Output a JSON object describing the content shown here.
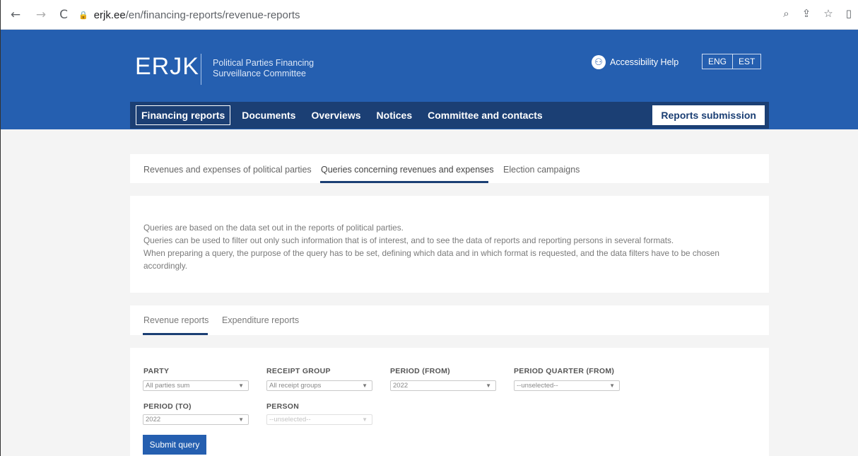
{
  "browser": {
    "back": "←",
    "forward": "→",
    "reload": "C",
    "lock": "🔒",
    "url_host": "erjk.ee",
    "url_path": "/en/financing-reports/revenue-reports",
    "icons": [
      "zoom-icon",
      "share-icon",
      "star-icon",
      "sidebar-icon"
    ]
  },
  "header": {
    "logo": "ERJK",
    "subtitle_line1": "Political Parties Financing",
    "subtitle_line2": "Surveillance Committee",
    "accessibility": "Accessibility Help",
    "lang_eng": "ENG",
    "lang_est": "EST"
  },
  "nav": {
    "items": [
      "Financing reports",
      "Documents",
      "Overviews",
      "Notices",
      "Committee and contacts"
    ],
    "reports_submission": "Reports submission"
  },
  "tabs": {
    "items": [
      "Revenues and expenses of political parties",
      "Queries concerning revenues and expenses",
      "Election campaigns"
    ],
    "active": "Queries concerning revenues and expenses"
  },
  "info": {
    "line1": "Queries are based on the data set out in the reports of political parties.",
    "line2": "Queries can be used to filter out only such information that is of interest, and to see the data of reports and reporting persons in several formats.",
    "line3": "When preparing a query, the purpose of the query has to be set, defining which data and in which format is requested, and the data filters have to be chosen accordingly."
  },
  "reports_tabs": {
    "revenue": "Revenue reports",
    "expenditure": "Expenditure reports"
  },
  "form": {
    "party_label": "PARTY",
    "party_value": "All parties sum",
    "receipt_label": "RECEIPT GROUP",
    "receipt_value": "All receipt groups",
    "period_from_label": "PERIOD (FROM)",
    "period_from_value": "2022",
    "quarter_label": "PERIOD QUARTER (FROM)",
    "quarter_value": "--unselected--",
    "period_to_label": "PERIOD (TO)",
    "period_to_value": "2022",
    "person_label": "PERSON",
    "person_value": "--unselected--",
    "submit": "Submit query"
  },
  "colors": {
    "header_blue": "#255fb0",
    "nav_dark": "#1b3f74",
    "page_bg": "#f4f4f4"
  }
}
